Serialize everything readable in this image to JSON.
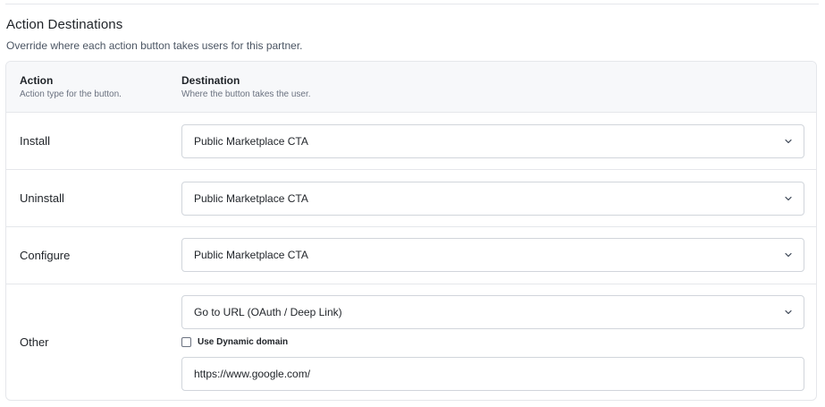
{
  "section": {
    "title": "Action Destinations",
    "description": "Override where each action button takes users for this partner."
  },
  "table": {
    "columns": [
      {
        "title": "Action",
        "subtitle": "Action type for the button."
      },
      {
        "title": "Destination",
        "subtitle": "Where the button takes the user."
      }
    ],
    "rows": [
      {
        "action": "Install",
        "destination": "Public Marketplace CTA"
      },
      {
        "action": "Uninstall",
        "destination": "Public Marketplace CTA"
      },
      {
        "action": "Configure",
        "destination": "Public Marketplace CTA"
      },
      {
        "action": "Other",
        "destination": "Go to URL (OAuth / Deep Link)",
        "dynamic_domain_label": "Use Dynamic domain",
        "dynamic_domain_checked": false,
        "url_value": "https://www.google.com/"
      }
    ]
  },
  "icons": {
    "select_chevron": "chevron-down-icon"
  }
}
